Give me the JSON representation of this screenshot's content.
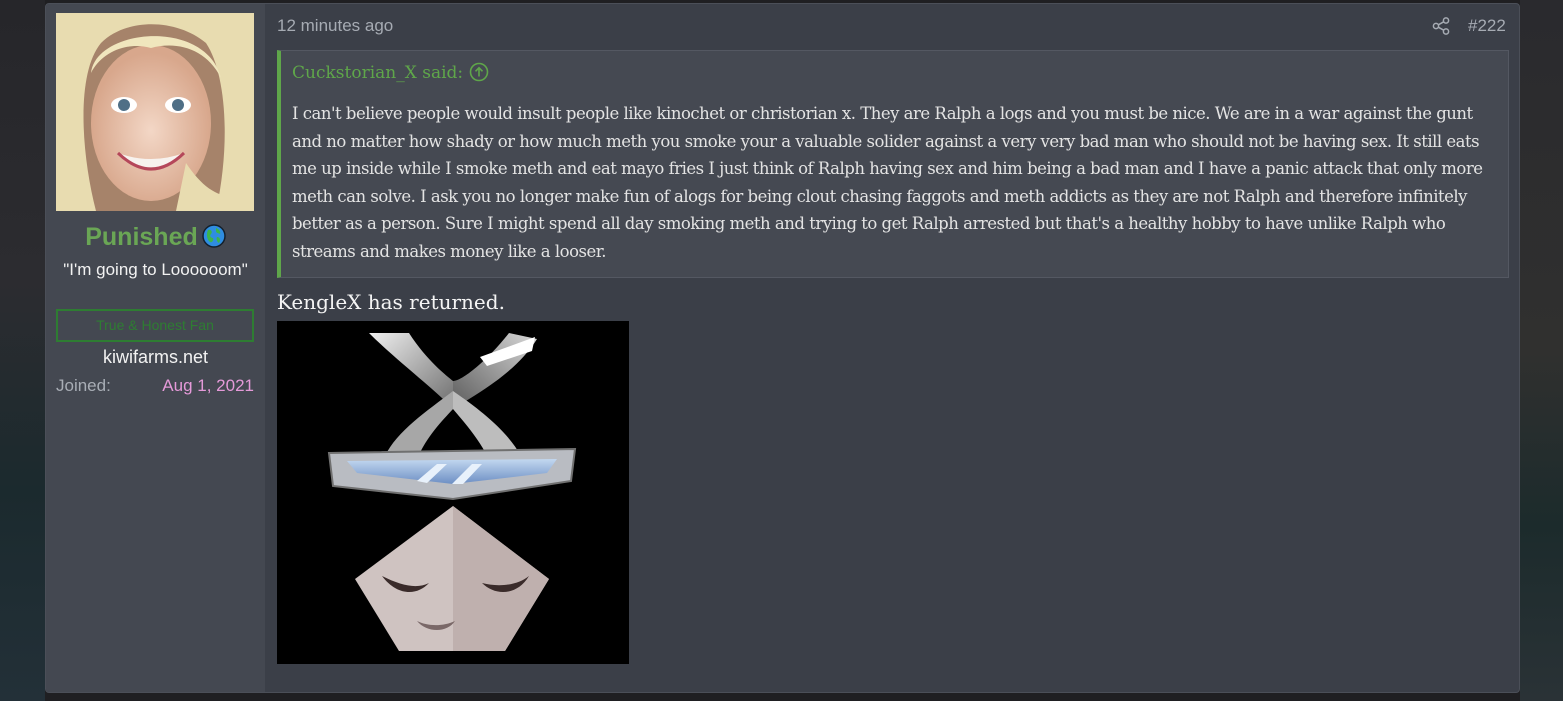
{
  "post": {
    "username": "Punished",
    "user_title": "\"I'm going to Loooooom\"",
    "banner": "True & Honest Fan",
    "site": "kiwifarms.net",
    "joined_label": "Joined:",
    "joined_value": "Aug 1, 2021",
    "timestamp": "12 minutes ago",
    "number": "#222",
    "quote": {
      "attribution": "Cuckstorian_X said:",
      "body": "I can't believe people would insult people like kinochet or christorian x. They are Ralph a logs and you must be nice. We are in a war against the gunt and no matter how shady or how much meth you smoke your a valuable solider against a very very bad man who should not be having sex. It still eats me up inside while I smoke meth and eat mayo fries I just think of Ralph having sex and him being a bad man and I have a panic attack that only more meth can solve. I ask you no longer make fun of alogs for being clout chasing faggots and meth addicts as they are not Ralph and therefore infinitely better as a person. Sure I might spend all day smoking meth and trying to get Ralph arrested but that's a healthy hobby to have unlike Ralph who streams and makes money like a looser."
    },
    "message": "KengleX has returned."
  },
  "colors": {
    "accent_green": "#5fa64a",
    "username_green": "#6aa655",
    "joined_pink": "#e59ad9"
  },
  "icons": [
    "globe-icon",
    "share-icon",
    "arrow-up-circle-icon"
  ]
}
